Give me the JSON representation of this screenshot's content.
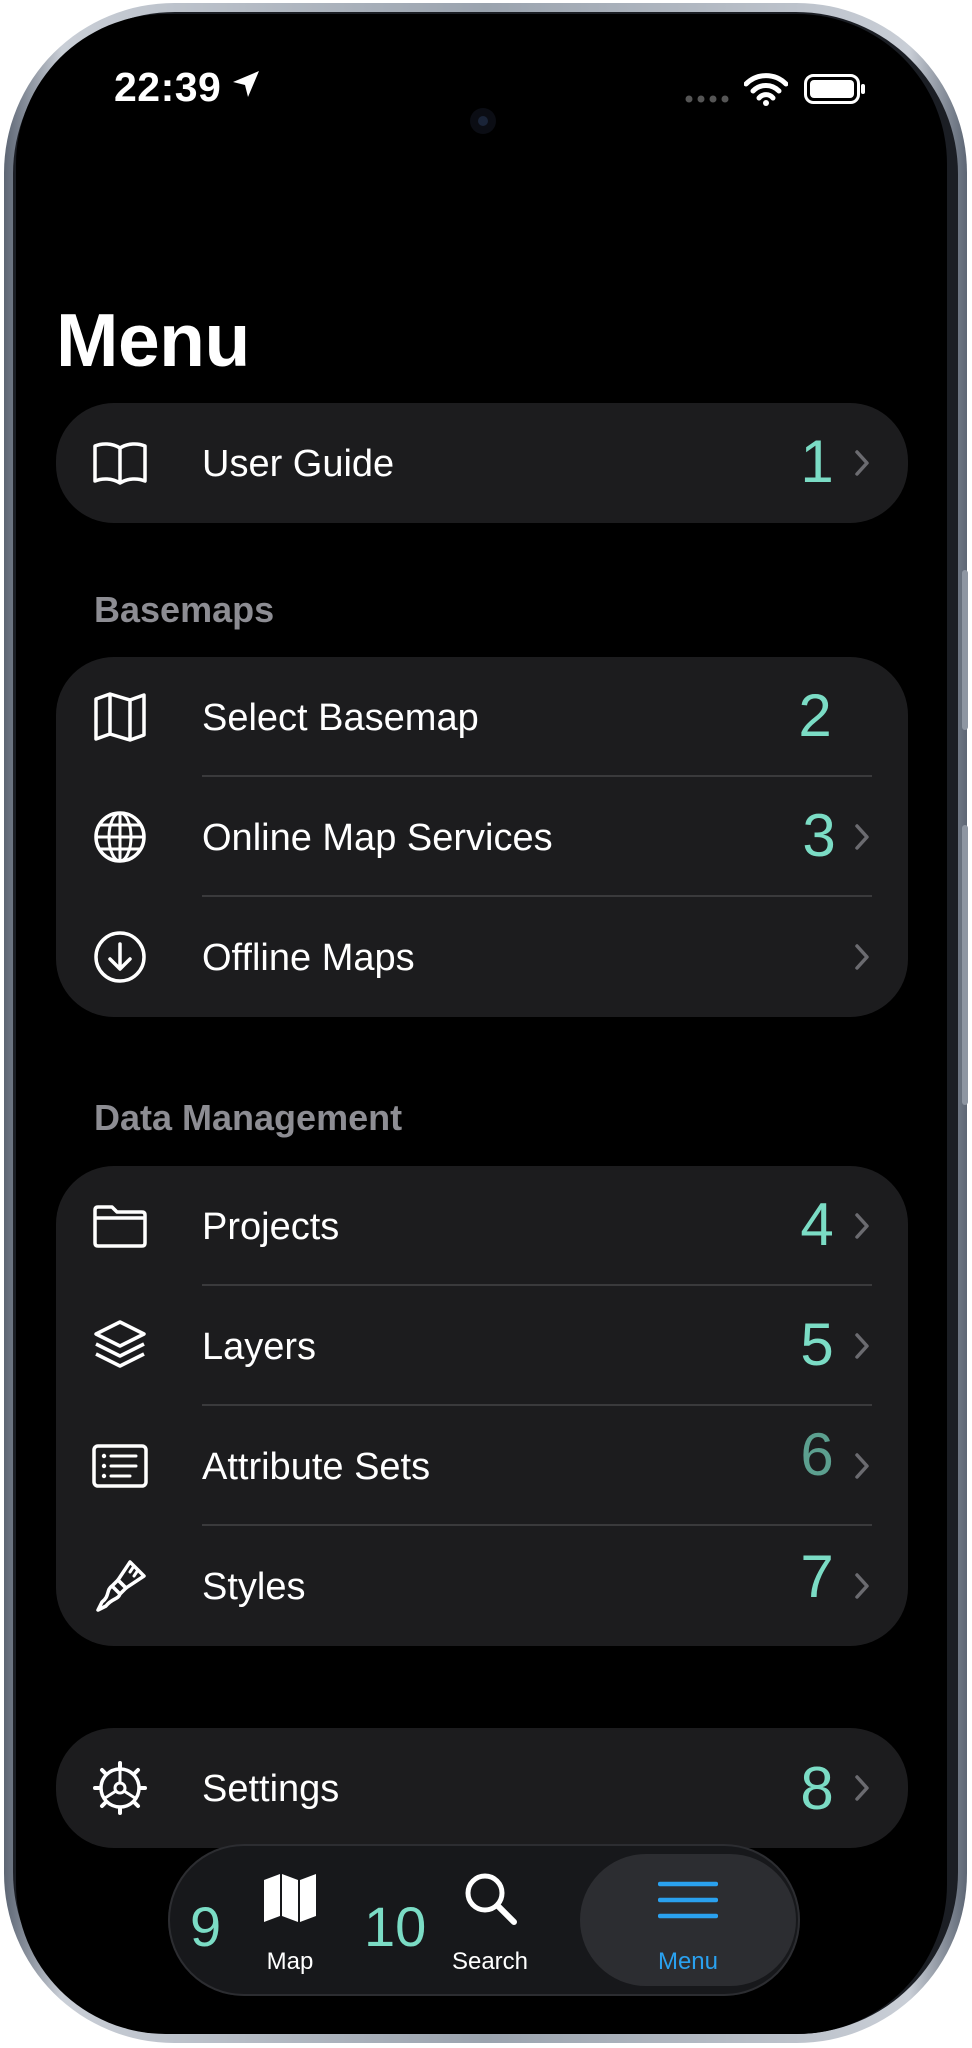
{
  "status": {
    "time": "22:39"
  },
  "page": {
    "title": "Menu"
  },
  "user_guide": {
    "label": "User Guide",
    "badge": "1"
  },
  "basemaps": {
    "header": "Basemaps",
    "items": [
      {
        "label": "Select Basemap",
        "badge": "2",
        "icon": "map-icon",
        "chevron": false
      },
      {
        "label": "Online Map Services",
        "badge": "3",
        "icon": "globe-icon",
        "chevron": true
      },
      {
        "label": "Offline Maps",
        "badge": "",
        "icon": "download-icon",
        "chevron": true
      }
    ]
  },
  "data_management": {
    "header": "Data Management",
    "items": [
      {
        "label": "Projects",
        "badge": "4",
        "icon": "folder-icon"
      },
      {
        "label": "Layers",
        "badge": "5",
        "icon": "layers-icon"
      },
      {
        "label": "Attribute Sets",
        "badge": "6",
        "icon": "list-icon"
      },
      {
        "label": "Styles",
        "badge": "7",
        "icon": "paintbrush-icon"
      }
    ]
  },
  "settings": {
    "label": "Settings",
    "badge": "8"
  },
  "tabbar": {
    "map_label": "Map",
    "map_badge": "9",
    "search_label": "Search",
    "search_badge": "10",
    "menu_label": "Menu"
  },
  "colors": {
    "accent": "#2aa1ef",
    "badge": "#7bdcc5",
    "card": "#1c1c1e",
    "background": "#000000"
  }
}
